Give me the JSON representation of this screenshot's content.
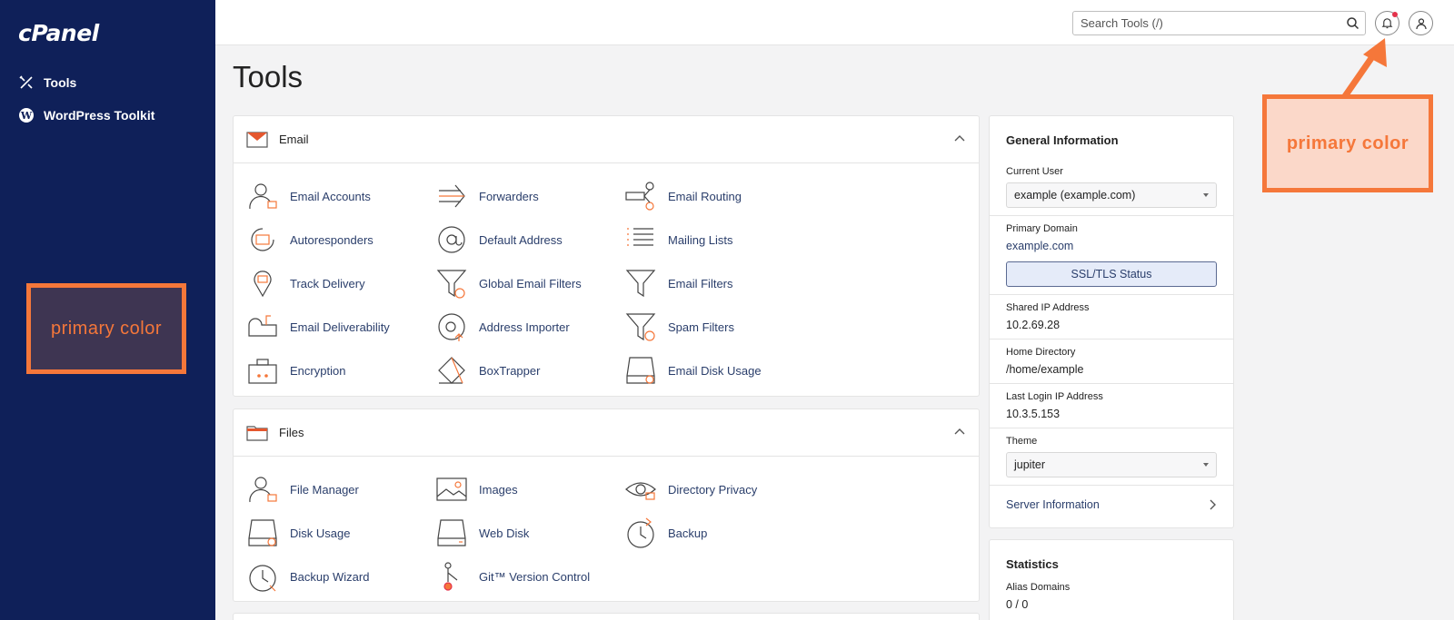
{
  "sidebar": {
    "logo": "cPanel",
    "items": [
      {
        "label": "Tools",
        "icon": "tools-icon"
      },
      {
        "label": "WordPress Toolkit",
        "icon": "wordpress-icon"
      }
    ]
  },
  "callouts": {
    "left": "primary color",
    "right": "primary color"
  },
  "topbar": {
    "search_placeholder": "Search Tools (/)"
  },
  "page": {
    "title": "Tools"
  },
  "email_section": {
    "title": "Email",
    "tools": [
      "Email Accounts",
      "Forwarders",
      "Email Routing",
      "Autoresponders",
      "Default Address",
      "Mailing Lists",
      "Track Delivery",
      "Global Email Filters",
      "Email Filters",
      "Email Deliverability",
      "Address Importer",
      "Spam Filters",
      "Encryption",
      "BoxTrapper",
      "Email Disk Usage"
    ]
  },
  "files_section": {
    "title": "Files",
    "tools": [
      "File Manager",
      "Images",
      "Directory Privacy",
      "Disk Usage",
      "Web Disk",
      "Backup",
      "Backup Wizard",
      "Git™ Version Control"
    ]
  },
  "general_info": {
    "title": "General Information",
    "current_user_label": "Current User",
    "current_user_value": "example (example.com)",
    "primary_domain_label": "Primary Domain",
    "primary_domain_value": "example.com",
    "ssl_button": "SSL/TLS Status",
    "shared_ip_label": "Shared IP Address",
    "shared_ip_value": "10.2.69.28",
    "home_dir_label": "Home Directory",
    "home_dir_value": "/home/example",
    "last_login_label": "Last Login IP Address",
    "last_login_value": "10.3.5.153",
    "theme_label": "Theme",
    "theme_value": "jupiter",
    "server_info": "Server Information"
  },
  "statistics": {
    "title": "Statistics",
    "alias_label": "Alias Domains",
    "alias_value": "0 / 0"
  },
  "colors": {
    "sidebar": "#0f2059",
    "accent_orange": "#f5773a",
    "link": "#2a3e6b"
  }
}
